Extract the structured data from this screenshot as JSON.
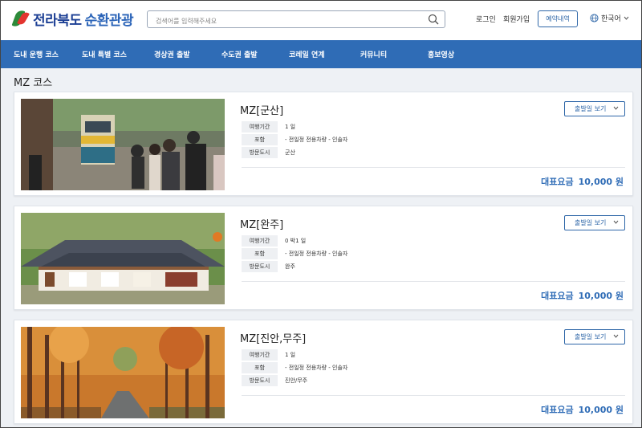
{
  "header": {
    "logo_main": "전라북도",
    "logo_sub": "순환관광",
    "search_placeholder": "검색어를 입력해주세요",
    "login": "로그인",
    "signup": "회원가입",
    "booking": "예약내역",
    "language": "한국어"
  },
  "nav": {
    "items": [
      "도내 운행 코스",
      "도내 특별 코스",
      "경상권 출발",
      "수도권 출발",
      "코레일 연계",
      "커뮤니티",
      "홍보영상"
    ]
  },
  "page": {
    "title": "MZ 코스"
  },
  "cards": [
    {
      "title": "MZ[군산]",
      "depart_label": "출발일 보기",
      "rows": [
        {
          "label": "여행기간",
          "value": "1 일"
        },
        {
          "label": "포함",
          "value": "- 전일정 전용차량 - 인솔자"
        },
        {
          "label": "방문도시",
          "value": "군산"
        }
      ],
      "price_label": "대표요금",
      "price_value": "10,000 원",
      "image": "train-station-crowd-photo"
    },
    {
      "title": "MZ[완주]",
      "depart_label": "출발일 보기",
      "rows": [
        {
          "label": "여행기간",
          "value": "0 박1 일"
        },
        {
          "label": "포함",
          "value": "- 전일정 전용차량 - 인솔자"
        },
        {
          "label": "방문도시",
          "value": "완주"
        }
      ],
      "price_label": "대표요금",
      "price_value": "10,000 원",
      "image": "hanok-house-photo"
    },
    {
      "title": "MZ[진안,무주]",
      "depart_label": "출발일 보기",
      "rows": [
        {
          "label": "여행기간",
          "value": "1 일"
        },
        {
          "label": "포함",
          "value": "- 전일정 전용차량 - 인솔자"
        },
        {
          "label": "방문도시",
          "value": "진안/무주"
        }
      ],
      "price_label": "대표요금",
      "price_value": "10,000 원",
      "image": "autumn-tree-road-photo"
    }
  ],
  "colors": {
    "nav_bg": "#2f6cb6",
    "accent": "#2f67a8",
    "price": "#2f6cb6"
  }
}
